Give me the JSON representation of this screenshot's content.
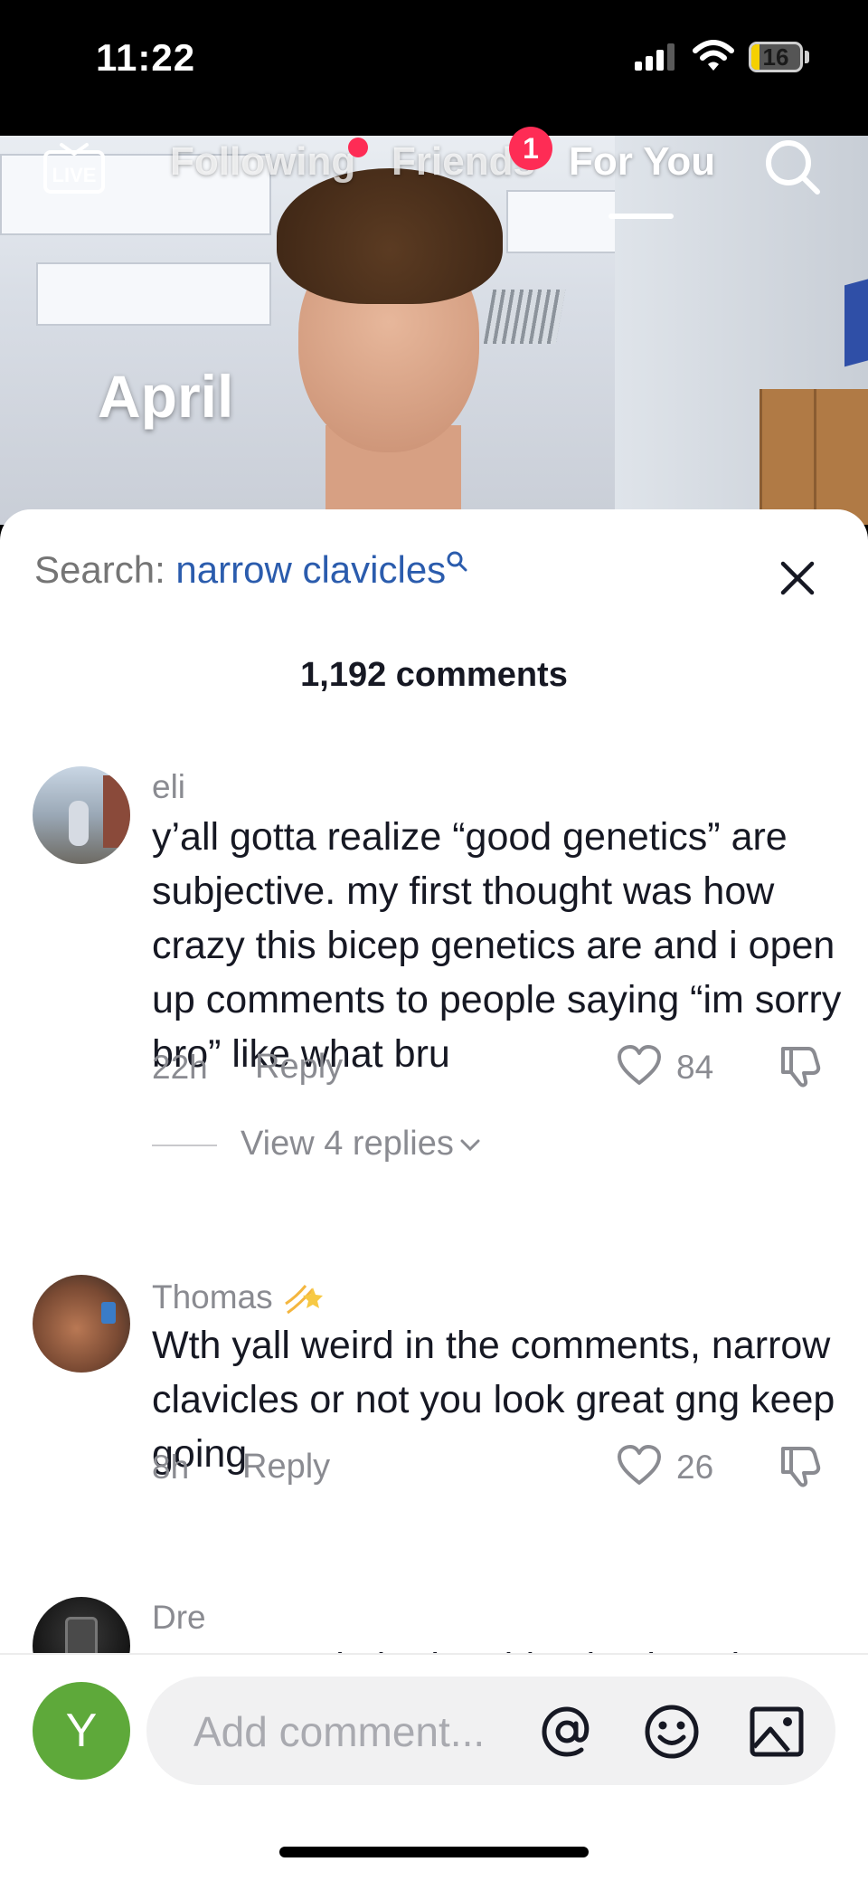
{
  "status_bar": {
    "time": "11:22",
    "battery": "16",
    "battery_level": 0.16
  },
  "video": {
    "caption": "April"
  },
  "top_nav": {
    "tabs": [
      {
        "label": "Following"
      },
      {
        "label": "Friends",
        "badge": "1"
      },
      {
        "label": "For You"
      }
    ],
    "live_icon": "live-tv-icon",
    "search_icon": "search-icon"
  },
  "comments_sheet": {
    "search_prefix": "Search:",
    "search_term": "narrow clavicles",
    "comment_count": "1,192 comments",
    "comments": [
      {
        "username": "eli",
        "text": "y’all gotta realize “good genetics” are subjective. my first thought was how crazy this bicep genetics are and i open up comments to people saying “im sorry bro” like what bru",
        "time": "22h",
        "reply_label": "Reply",
        "likes": "84",
        "view_replies": "View 4 replies"
      },
      {
        "username": "Thomas",
        "text": "Wth yall weird in the comments, narrow clavicles or not you look great gng keep going",
        "time": "8h",
        "reply_label": "Reply",
        "likes": "26"
      },
      {
        "username": "Dre",
        "text": "y are people hating this physique is"
      }
    ]
  },
  "comment_input": {
    "avatar_letter": "Y",
    "placeholder": "Add comment...",
    "icons": [
      "mention-icon",
      "emoji-icon",
      "image-icon"
    ]
  },
  "colors": {
    "accent": "#fe2c55",
    "search_term": "#2b5cad",
    "avatar_bg": "#5ea93a"
  }
}
